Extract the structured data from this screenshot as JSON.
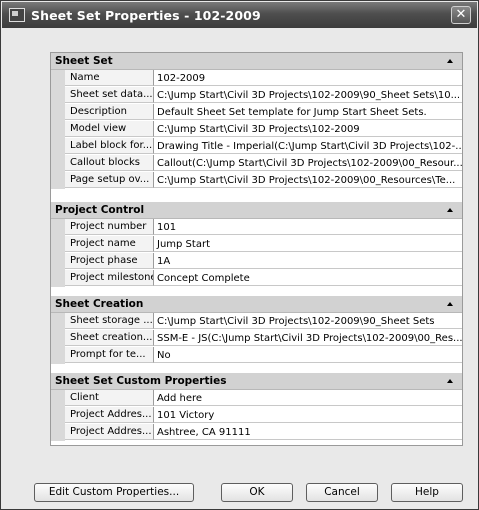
{
  "window": {
    "title": "Sheet Set Properties - 102-2009",
    "close_glyph": "✕"
  },
  "categories": [
    {
      "label": "Sheet Set",
      "rows": [
        {
          "name": "Name",
          "value": "102-2009"
        },
        {
          "name": "Sheet set data...",
          "value": "C:\\Jump Start\\Civil 3D Projects\\102-2009\\90_Sheet Sets\\10..."
        },
        {
          "name": "Description",
          "value": "Default Sheet Set template for Jump Start Sheet Sets."
        },
        {
          "name": "Model view",
          "value": "C:\\Jump Start\\Civil 3D Projects\\102-2009"
        },
        {
          "name": "Label block for...",
          "value": "Drawing Title - Imperial(C:\\Jump Start\\Civil 3D Projects\\102-..."
        },
        {
          "name": "Callout blocks",
          "value": "Callout(C:\\Jump Start\\Civil 3D Projects\\102-2009\\00_Resour..."
        },
        {
          "name": "Page setup ov...",
          "value": "C:\\Jump Start\\Civil 3D Projects\\102-2009\\00_Resources\\Te..."
        }
      ]
    },
    {
      "label": "Project Control",
      "rows": [
        {
          "name": "Project number",
          "value": "101"
        },
        {
          "name": "Project name",
          "value": "Jump Start"
        },
        {
          "name": "Project phase",
          "value": "1A"
        },
        {
          "name": "Project milestone",
          "value": "Concept Complete"
        }
      ]
    },
    {
      "label": "Sheet Creation",
      "rows": [
        {
          "name": "Sheet storage ...",
          "value": "C:\\Jump Start\\Civil 3D Projects\\102-2009\\90_Sheet Sets"
        },
        {
          "name": "Sheet creation...",
          "value": "SSM-E - JS(C:\\Jump Start\\Civil 3D Projects\\102-2009\\00_Res..."
        },
        {
          "name": "Prompt for te...",
          "value": "No"
        }
      ]
    },
    {
      "label": "Sheet Set Custom Properties",
      "rows": [
        {
          "name": "Client",
          "value": "Add here"
        },
        {
          "name": "Project Addres...",
          "value": "101 Victory"
        },
        {
          "name": "Project Addres...",
          "value": "Ashtree, CA 91111"
        }
      ]
    }
  ],
  "buttons": {
    "edit_custom": "Edit Custom Properties...",
    "ok": "OK",
    "cancel": "Cancel",
    "help": "Help"
  },
  "icons": {
    "app": "sheet-set-icon",
    "close": "close-icon",
    "collapse": "collapse-arrow-icon"
  }
}
